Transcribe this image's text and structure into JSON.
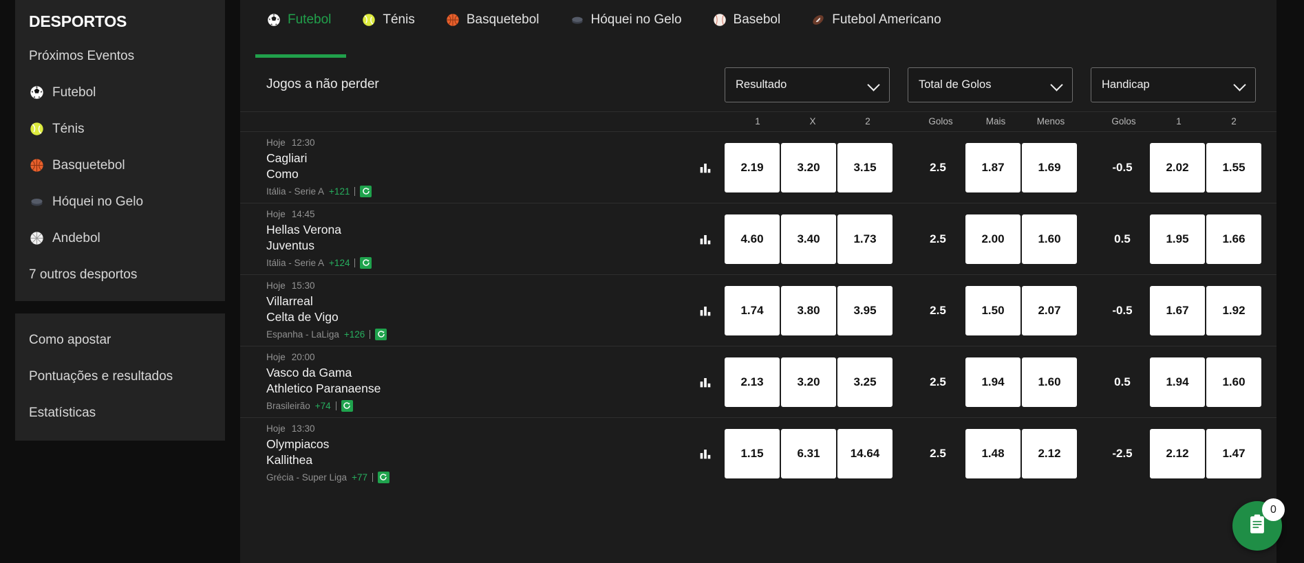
{
  "sidebar": {
    "title": "DESPORTOS",
    "primary_items": [
      {
        "label": "Próximos Eventos",
        "icon": "none"
      },
      {
        "label": "Futebol",
        "icon": "soccer-ball-icon"
      },
      {
        "label": "Ténis",
        "icon": "tennis-ball-icon"
      },
      {
        "label": "Basquetebol",
        "icon": "basketball-icon"
      },
      {
        "label": "Hóquei no Gelo",
        "icon": "hockey-puck-icon"
      },
      {
        "label": "Andebol",
        "icon": "handball-icon"
      },
      {
        "label": "7 outros desportos",
        "icon": "none"
      }
    ],
    "secondary_items": [
      {
        "label": "Como apostar"
      },
      {
        "label": "Pontuações e resultados"
      },
      {
        "label": "Estatísticas"
      }
    ]
  },
  "tabs": [
    {
      "label": "Futebol",
      "icon": "soccer-ball-icon",
      "active": true
    },
    {
      "label": "Ténis",
      "icon": "tennis-ball-icon",
      "active": false
    },
    {
      "label": "Basquetebol",
      "icon": "basketball-icon",
      "active": false
    },
    {
      "label": "Hóquei no Gelo",
      "icon": "hockey-puck-icon",
      "active": false
    },
    {
      "label": "Basebol",
      "icon": "baseball-icon",
      "active": false
    },
    {
      "label": "Futebol Americano",
      "icon": "american-football-icon",
      "active": false
    }
  ],
  "filters": {
    "section_title": "Jogos a não perder",
    "selects": [
      {
        "value": "Resultado"
      },
      {
        "value": "Total de Golos"
      },
      {
        "value": "Handicap"
      }
    ]
  },
  "columns": {
    "result": [
      "1",
      "X",
      "2"
    ],
    "totals": [
      "Golos",
      "Mais",
      "Menos"
    ],
    "handicap": [
      "Golos",
      "1",
      "2"
    ]
  },
  "matches": [
    {
      "day": "Hoje",
      "time": "12:30",
      "home": "Cagliari",
      "away": "Como",
      "league": "Itália - Serie A",
      "more_markets": "+121",
      "result": [
        "2.19",
        "3.20",
        "3.15"
      ],
      "totals_line": "2.5",
      "totals": [
        "1.87",
        "1.69"
      ],
      "handicap_line": "-0.5",
      "handicap": [
        "2.02",
        "1.55"
      ]
    },
    {
      "day": "Hoje",
      "time": "14:45",
      "home": "Hellas Verona",
      "away": "Juventus",
      "league": "Itália - Serie A",
      "more_markets": "+124",
      "result": [
        "4.60",
        "3.40",
        "1.73"
      ],
      "totals_line": "2.5",
      "totals": [
        "2.00",
        "1.60"
      ],
      "handicap_line": "0.5",
      "handicap": [
        "1.95",
        "1.66"
      ]
    },
    {
      "day": "Hoje",
      "time": "15:30",
      "home": "Villarreal",
      "away": "Celta de Vigo",
      "league": "Espanha - LaLiga",
      "more_markets": "+126",
      "result": [
        "1.74",
        "3.80",
        "3.95"
      ],
      "totals_line": "2.5",
      "totals": [
        "1.50",
        "2.07"
      ],
      "handicap_line": "-0.5",
      "handicap": [
        "1.67",
        "1.92"
      ]
    },
    {
      "day": "Hoje",
      "time": "20:00",
      "home": "Vasco da Gama",
      "away": "Athletico Paranaense",
      "league": "Brasileirão",
      "more_markets": "+74",
      "result": [
        "2.13",
        "3.20",
        "3.25"
      ],
      "totals_line": "2.5",
      "totals": [
        "1.94",
        "1.60"
      ],
      "handicap_line": "0.5",
      "handicap": [
        "1.94",
        "1.60"
      ]
    },
    {
      "day": "Hoje",
      "time": "13:30",
      "home": "Olympiacos",
      "away": "Kallithea",
      "league": "Grécia - Super Liga",
      "more_markets": "+77",
      "result": [
        "1.15",
        "6.31",
        "14.64"
      ],
      "totals_line": "2.5",
      "totals": [
        "1.48",
        "2.12"
      ],
      "handicap_line": "-2.5",
      "handicap": [
        "2.12",
        "1.47"
      ]
    }
  ],
  "betslip": {
    "count": "0",
    "icon": "betslip-clipboard-icon"
  },
  "colors": {
    "accent_green": "#21a04b",
    "badge_green": "#1fa34d",
    "page_bg": "#0e0e0e",
    "card_bg": "#1c1c1c",
    "panel_bg": "#232323",
    "odd_bg": "#ffffff"
  }
}
